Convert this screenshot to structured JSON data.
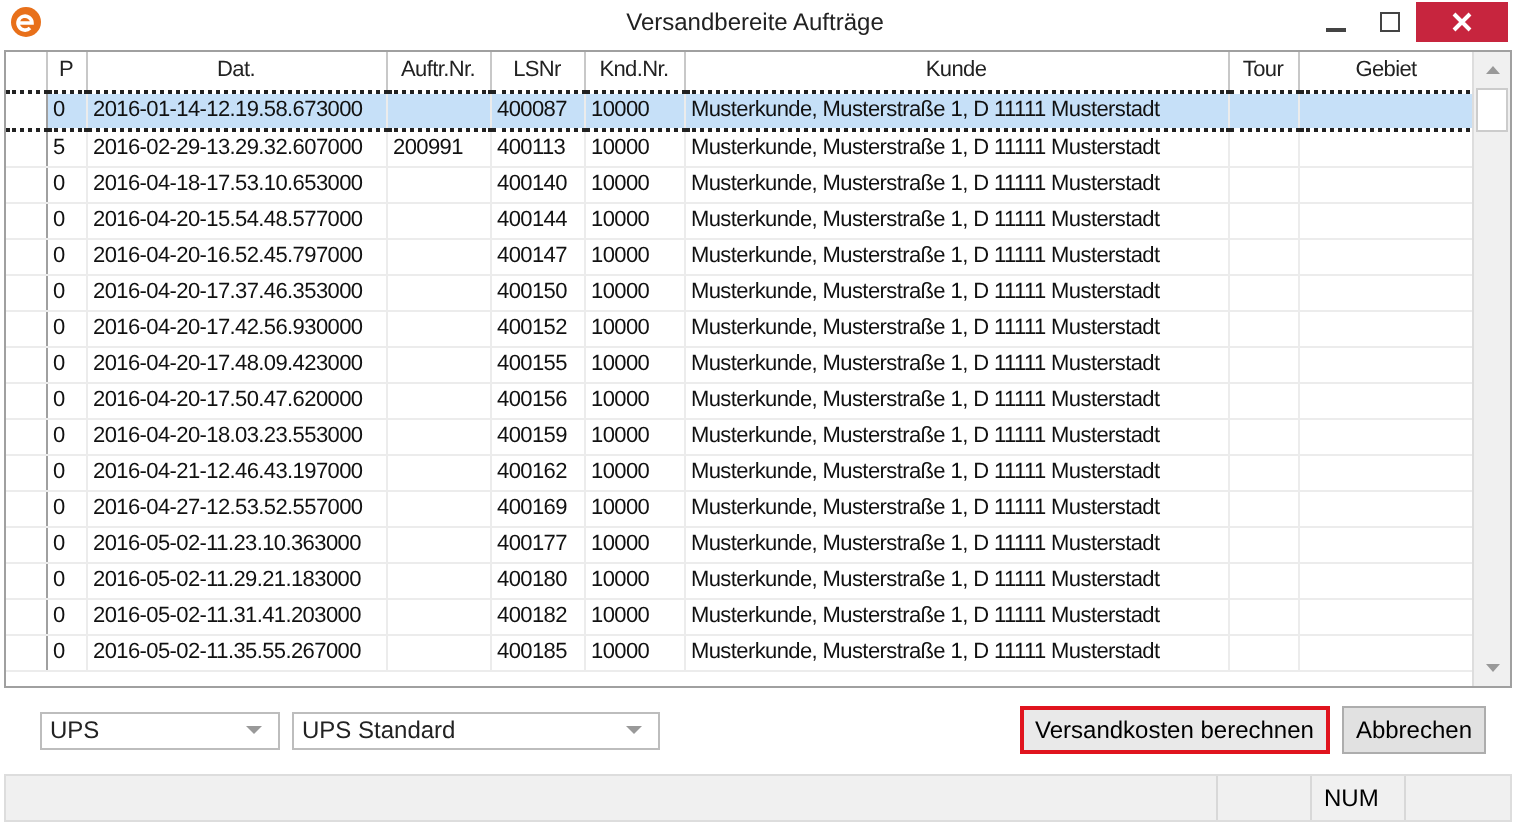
{
  "window": {
    "title": "Versandbereite Aufträge"
  },
  "table": {
    "columns": [
      "P",
      "Dat.",
      "Auftr.Nr.",
      "LSNr",
      "Knd.Nr.",
      "Kunde",
      "Tour",
      "Gebiet"
    ],
    "rows": [
      {
        "p": "0",
        "date": "2016-01-14-12.19.58.673000",
        "lsnr": "400087",
        "customer_no": "10000",
        "customer": "Musterkunde, Musterstraße 1, D 11111 Musterstadt",
        "selected": true
      },
      {
        "p": "5",
        "date": "2016-02-29-13.29.32.607000",
        "order_no": "200991",
        "lsnr": "400113",
        "customer_no": "10000",
        "customer": "Musterkunde, Musterstraße 1, D 11111 Musterstadt",
        "selected": false
      },
      {
        "p": "0",
        "date": "2016-04-18-17.53.10.653000",
        "lsnr": "400140",
        "customer_no": "10000",
        "customer": "Musterkunde, Musterstraße 1, D 11111 Musterstadt",
        "selected": false
      },
      {
        "p": "0",
        "date": "2016-04-20-15.54.48.577000",
        "lsnr": "400144",
        "customer_no": "10000",
        "customer": "Musterkunde, Musterstraße 1, D 11111 Musterstadt",
        "selected": false
      },
      {
        "p": "0",
        "date": "2016-04-20-16.52.45.797000",
        "lsnr": "400147",
        "customer_no": "10000",
        "customer": "Musterkunde, Musterstraße 1, D 11111 Musterstadt",
        "selected": false
      },
      {
        "p": "0",
        "date": "2016-04-20-17.37.46.353000",
        "lsnr": "400150",
        "customer_no": "10000",
        "customer": "Musterkunde, Musterstraße 1, D 11111 Musterstadt",
        "selected": false
      },
      {
        "p": "0",
        "date": "2016-04-20-17.42.56.930000",
        "lsnr": "400152",
        "customer_no": "10000",
        "customer": "Musterkunde, Musterstraße 1, D 11111 Musterstadt",
        "selected": false
      },
      {
        "p": "0",
        "date": "2016-04-20-17.48.09.423000",
        "lsnr": "400155",
        "customer_no": "10000",
        "customer": "Musterkunde, Musterstraße 1, D 11111 Musterstadt",
        "selected": false
      },
      {
        "p": "0",
        "date": "2016-04-20-17.50.47.620000",
        "lsnr": "400156",
        "customer_no": "10000",
        "customer": "Musterkunde, Musterstraße 1, D 11111 Musterstadt",
        "selected": false
      },
      {
        "p": "0",
        "date": "2016-04-20-18.03.23.553000",
        "lsnr": "400159",
        "customer_no": "10000",
        "customer": "Musterkunde, Musterstraße 1, D 11111 Musterstadt",
        "selected": false
      },
      {
        "p": "0",
        "date": "2016-04-21-12.46.43.197000",
        "lsnr": "400162",
        "customer_no": "10000",
        "customer": "Musterkunde, Musterstraße 1, D 11111 Musterstadt",
        "selected": false
      },
      {
        "p": "0",
        "date": "2016-04-27-12.53.52.557000",
        "lsnr": "400169",
        "customer_no": "10000",
        "customer": "Musterkunde, Musterstraße 1, D 11111 Musterstadt",
        "selected": false
      },
      {
        "p": "0",
        "date": "2016-05-02-11.23.10.363000",
        "lsnr": "400177",
        "customer_no": "10000",
        "customer": "Musterkunde, Musterstraße 1, D 11111 Musterstadt",
        "selected": false
      },
      {
        "p": "0",
        "date": "2016-05-02-11.29.21.183000",
        "lsnr": "400180",
        "customer_no": "10000",
        "customer": "Musterkunde, Musterstraße 1, D 11111 Musterstadt",
        "selected": false
      },
      {
        "p": "0",
        "date": "2016-05-02-11.31.41.203000",
        "lsnr": "400182",
        "customer_no": "10000",
        "customer": "Musterkunde, Musterstraße 1, D 11111 Musterstadt",
        "selected": false
      },
      {
        "p": "0",
        "date": "2016-05-02-11.35.55.267000",
        "lsnr": "400185",
        "customer_no": "10000",
        "customer": "Musterkunde, Musterstraße 1, D 11111 Musterstadt",
        "selected": false
      }
    ]
  },
  "carrier": {
    "value": "UPS"
  },
  "service": {
    "value": "UPS Standard"
  },
  "buttons": [
    {
      "label": "Versandkosten berechnen",
      "focused": true
    },
    {
      "label": "Abbrechen",
      "focused": false
    }
  ],
  "status_bar": {
    "panel_3": "NUM"
  }
}
